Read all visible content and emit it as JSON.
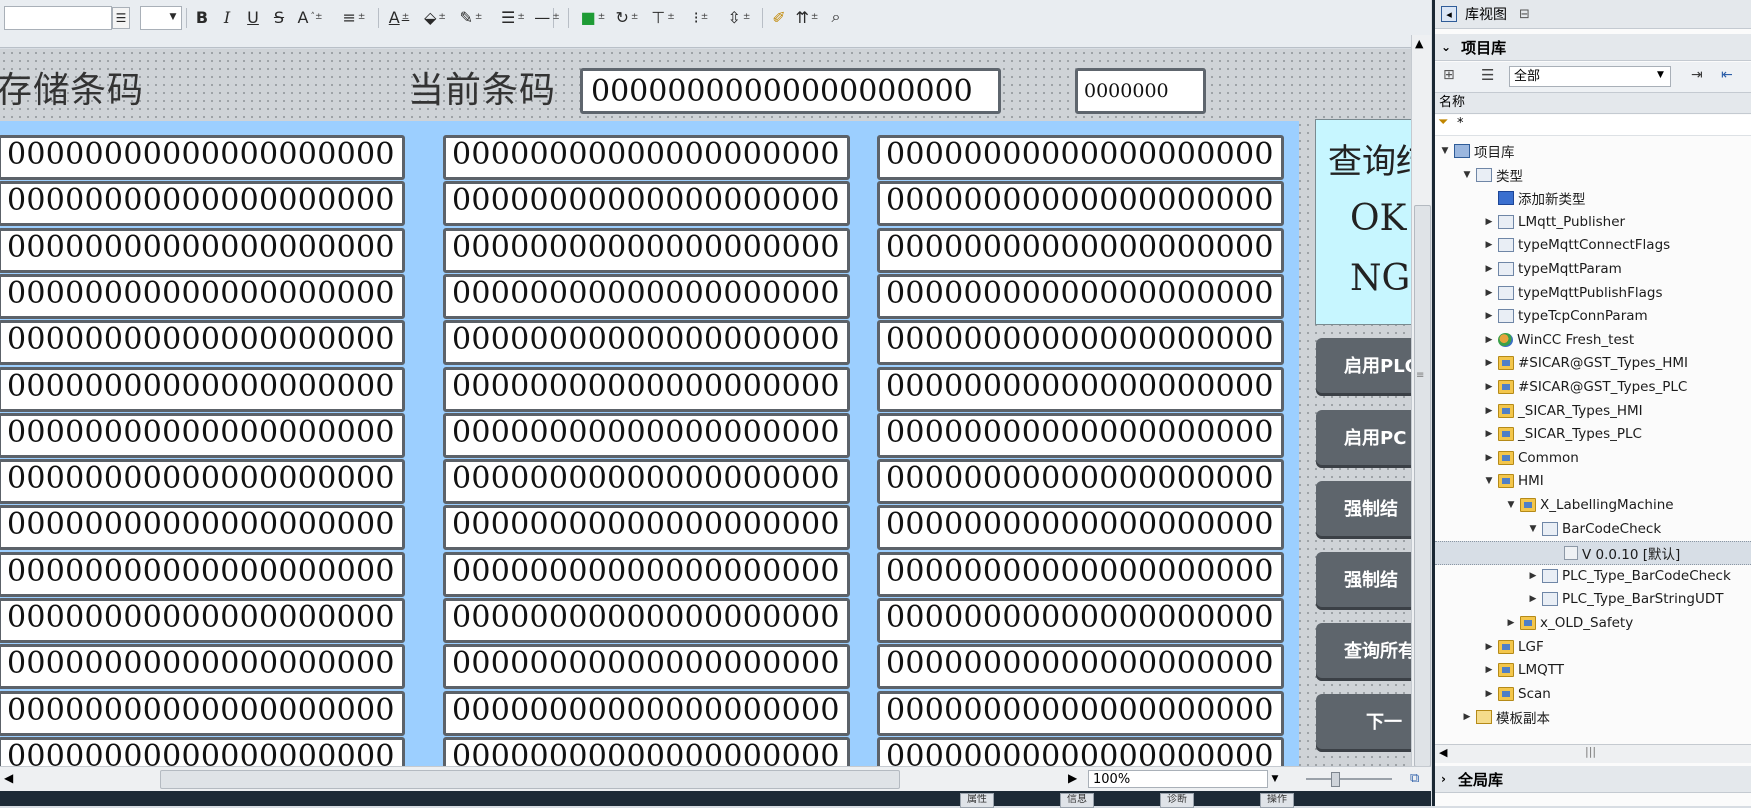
{
  "toolbar": {
    "font_name_value": "",
    "font_size_value": "",
    "icons": [
      "bold-icon",
      "italic-icon",
      "underline-icon",
      "strikethrough-icon",
      "font-size-icon",
      "align-icon",
      "text-color-icon",
      "fill-color-icon",
      "line-color-icon",
      "line-width-icon",
      "line-style-icon",
      "fill-pattern-icon",
      "rotate-icon",
      "align-top-icon",
      "distribute-icon",
      "layer-icon",
      "format-painter-icon",
      "layer-order-icon",
      "zoom-select-icon"
    ],
    "text": {
      "bold": "B",
      "italic": "I",
      "underline": "U",
      "strike": "S",
      "fontsize": "A",
      "textcolor": "A"
    }
  },
  "screen": {
    "stored_barcode_label": "存储条码",
    "current_barcode_label": "当前条码",
    "current_barcode_value": "00000000000000000000",
    "counter_value": "0000000",
    "grid_value": "00000000000000000000",
    "grid_rows": 14,
    "grid_columns": 3,
    "query_box": {
      "title": "查询结",
      "ok": "OK",
      "ng": "NG"
    },
    "side_buttons": [
      "启用PLC",
      "启用PC",
      "强制结",
      "强制结",
      "查询所有",
      "下一"
    ]
  },
  "statusbar": {
    "zoom": "100%",
    "tabs": [
      "属性",
      "信息",
      "诊断",
      "操作"
    ]
  },
  "library": {
    "library_view_label": "库视图",
    "project_library_title": "项目库",
    "filter_value": "全部",
    "name_column": "名称",
    "filter_text": "*",
    "global_library_title": "全局库",
    "tree": [
      {
        "label": "项目库",
        "level": 0,
        "state": "open",
        "icon": "lib"
      },
      {
        "label": "类型",
        "level": 1,
        "state": "open",
        "icon": "type"
      },
      {
        "label": "添加新类型",
        "level": 2,
        "state": "none",
        "icon": "add"
      },
      {
        "label": "LMqtt_Publisher",
        "level": 2,
        "state": "closed",
        "icon": "type"
      },
      {
        "label": "typeMqttConnectFlags",
        "level": 2,
        "state": "closed",
        "icon": "type"
      },
      {
        "label": "typeMqttParam",
        "level": 2,
        "state": "closed",
        "icon": "type"
      },
      {
        "label": "typeMqttPublishFlags",
        "level": 2,
        "state": "closed",
        "icon": "type"
      },
      {
        "label": "typeTcpConnParam",
        "level": 2,
        "state": "closed",
        "icon": "type"
      },
      {
        "label": "WinCC Fresh_test",
        "level": 2,
        "state": "closed",
        "icon": "globe"
      },
      {
        "label": "#SICAR@GST_Types_HMI",
        "level": 2,
        "state": "closed",
        "icon": "folder"
      },
      {
        "label": "#SICAR@GST_Types_PLC",
        "level": 2,
        "state": "closed",
        "icon": "folder"
      },
      {
        "label": "_SICAR_Types_HMI",
        "level": 2,
        "state": "closed",
        "icon": "folder"
      },
      {
        "label": "_SICAR_Types_PLC",
        "level": 2,
        "state": "closed",
        "icon": "folder"
      },
      {
        "label": "Common",
        "level": 2,
        "state": "closed",
        "icon": "folder"
      },
      {
        "label": "HMI",
        "level": 2,
        "state": "open",
        "icon": "folder"
      },
      {
        "label": "X_LabellingMachine",
        "level": 3,
        "state": "open",
        "icon": "folder"
      },
      {
        "label": "BarCodeCheck",
        "level": 4,
        "state": "open",
        "icon": "type"
      },
      {
        "label": "V 0.0.10 [默认]",
        "level": 5,
        "state": "none",
        "icon": "ver",
        "selected": true
      },
      {
        "label": "PLC_Type_BarCodeCheck",
        "level": 4,
        "state": "closed",
        "icon": "type"
      },
      {
        "label": "PLC_Type_BarStringUDT",
        "level": 4,
        "state": "closed",
        "icon": "type"
      },
      {
        "label": "x_OLD_Safety",
        "level": 3,
        "state": "closed",
        "icon": "folder"
      },
      {
        "label": "LGF",
        "level": 2,
        "state": "closed",
        "icon": "folder"
      },
      {
        "label": "LMQTT",
        "level": 2,
        "state": "closed",
        "icon": "folder"
      },
      {
        "label": "Scan",
        "level": 2,
        "state": "closed",
        "icon": "folder"
      },
      {
        "label": "模板副本",
        "level": 1,
        "state": "closed",
        "icon": "tmpl"
      }
    ]
  },
  "colors": {
    "blue_panel": "#9ccfff",
    "query_box": "#c7f6ff",
    "button": "#5e656c",
    "dark_frame": "#1a2733"
  }
}
